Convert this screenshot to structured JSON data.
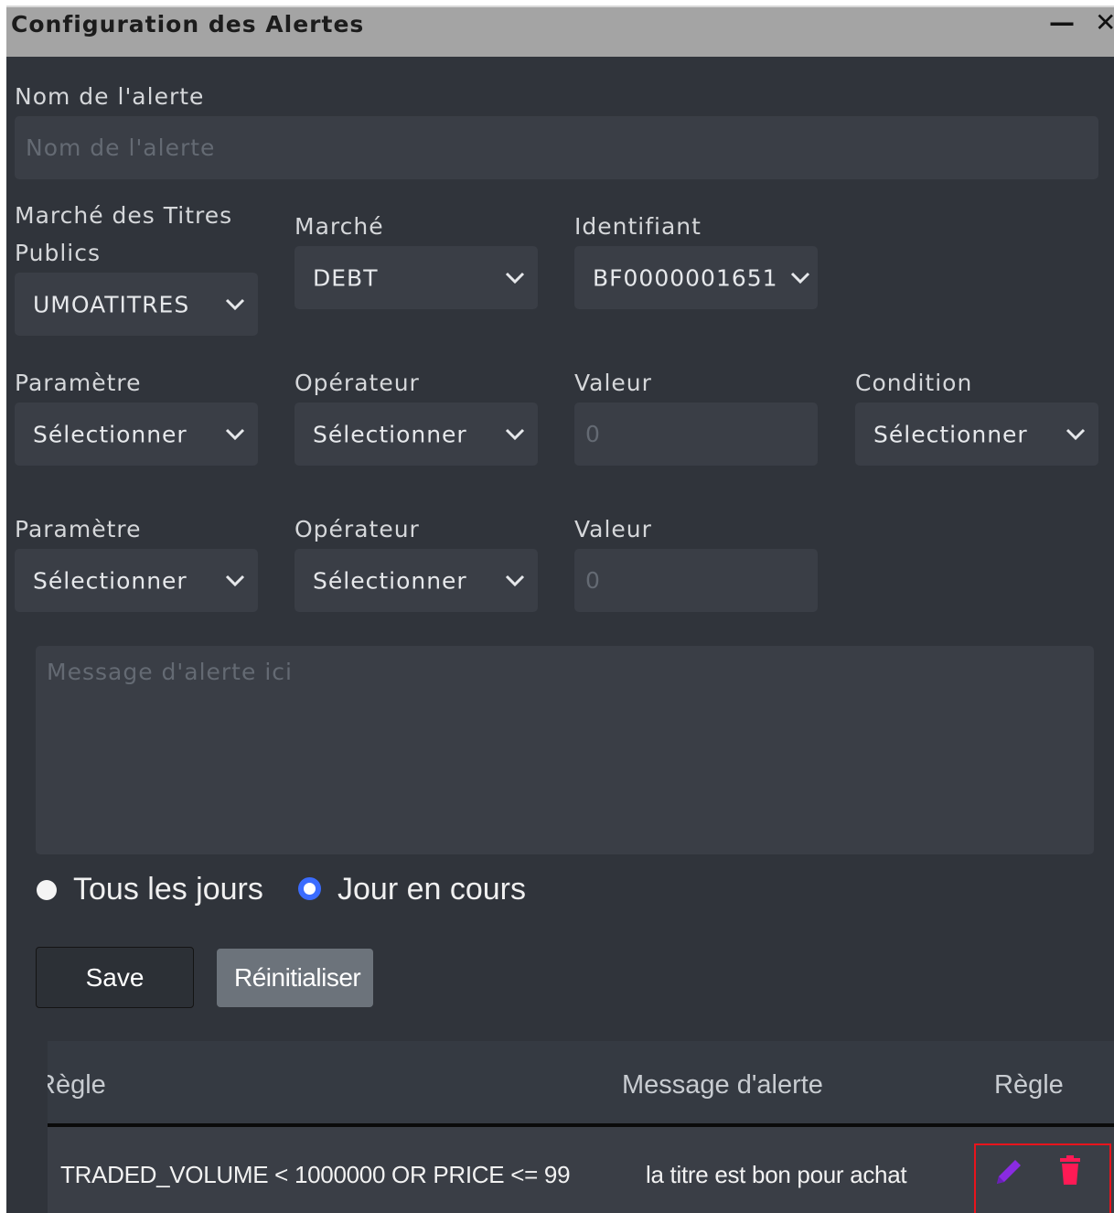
{
  "window": {
    "title": "Configuration des Alertes",
    "minimize": "—",
    "close": "✕"
  },
  "form": {
    "name_label": "Nom de l'alerte",
    "name_placeholder": "Nom de l'alerte",
    "market_group_label": "Marché des Titres Publics",
    "market_group_value": "UMOATITRES",
    "market_label": "Marché",
    "market_value": "DEBT",
    "identifier_label": "Identifiant",
    "identifier_value": "BF0000001651",
    "row1": {
      "param_label": "Paramètre",
      "param_value": "Sélectionner",
      "operator_label": "Opérateur",
      "operator_value": "Sélectionner",
      "value_label": "Valeur",
      "value_placeholder": "0",
      "condition_label": "Condition",
      "condition_value": "Sélectionner"
    },
    "row2": {
      "param_label": "Paramètre",
      "param_value": "Sélectionner",
      "operator_label": "Opérateur",
      "operator_value": "Sélectionner",
      "value_label": "Valeur",
      "value_placeholder": "0"
    },
    "message_placeholder": "Message d'alerte ici",
    "radio": {
      "option1": "Tous les jours",
      "option2": "Jour en cours",
      "selected": "Jour en cours"
    },
    "save_label": "Save",
    "reset_label": "Réinitialiser"
  },
  "table": {
    "headers": [
      "Règle",
      "Message d'alerte",
      "Règle"
    ],
    "rows": [
      {
        "rule": "TRADED_VOLUME < 1000000 OR PRICE <= 99",
        "message": "la titre est bon pour achat"
      }
    ]
  },
  "icons": {
    "edit": "pencil-icon",
    "delete": "trash-icon"
  },
  "colors": {
    "edit_icon": "#8a2be2",
    "delete_icon": "#ff1a55",
    "highlight_box": "#e8141c",
    "radio_selected": "#3b6cff"
  }
}
